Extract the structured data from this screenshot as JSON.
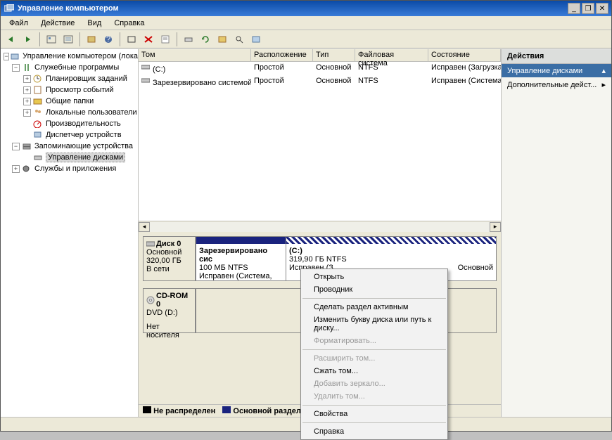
{
  "window": {
    "title": "Управление компьютером"
  },
  "menu": {
    "file": "Файл",
    "action": "Действие",
    "view": "Вид",
    "help": "Справка"
  },
  "tree": {
    "root": "Управление компьютером (лока",
    "sys_tools": "Служебные программы",
    "scheduler": "Планировщик заданий",
    "events": "Просмотр событий",
    "shares": "Общие папки",
    "users": "Локальные пользователи",
    "perf": "Производительность",
    "devmgr": "Диспетчер устройств",
    "storage": "Запоминающие устройства",
    "diskmgmt": "Управление дисками",
    "services": "Службы и приложения"
  },
  "vol_list": {
    "cols": {
      "vol": "Том",
      "layout": "Расположение",
      "type": "Тип",
      "fs": "Файловая система",
      "status": "Состояние"
    },
    "rows": [
      {
        "vol": "(C:)",
        "layout": "Простой",
        "type": "Основной",
        "fs": "NTFS",
        "status": "Исправен (Загрузка, Файл подкачки, Авар"
      },
      {
        "vol": "Зарезервировано системой",
        "layout": "Простой",
        "type": "Основной",
        "fs": "NTFS",
        "status": "Исправен (Система, Активен, Основной ра"
      }
    ]
  },
  "disks": {
    "disk0": {
      "label": "Диск 0",
      "type": "Основной",
      "size": "320,00 ГБ",
      "state": "В сети"
    },
    "reserved": {
      "name": "Зарезервировано сис",
      "size": "100 МБ NTFS",
      "state": "Исправен (Система, Акти"
    },
    "c": {
      "name": "(C:)",
      "size": "319,90 ГБ NTFS",
      "state": "Исправен (З",
      "state2": "Основной"
    },
    "cd": {
      "label": "CD-ROM 0",
      "type": "DVD (D:)",
      "state": "Нет носителя"
    }
  },
  "legend": {
    "unalloc": "Не распределен",
    "primary": "Основной раздел"
  },
  "actions": {
    "header": "Действия",
    "sub": "Управление дисками",
    "more": "Дополнительные дейст..."
  },
  "context": {
    "open": "Открыть",
    "explorer": "Проводник",
    "mark_active": "Сделать раздел активным",
    "change_letter": "Изменить букву диска или путь к диску...",
    "format": "Форматировать...",
    "extend": "Расширить том...",
    "shrink": "Сжать том...",
    "mirror": "Добавить зеркало...",
    "delete": "Удалить том...",
    "props": "Свойства",
    "help": "Справка"
  }
}
